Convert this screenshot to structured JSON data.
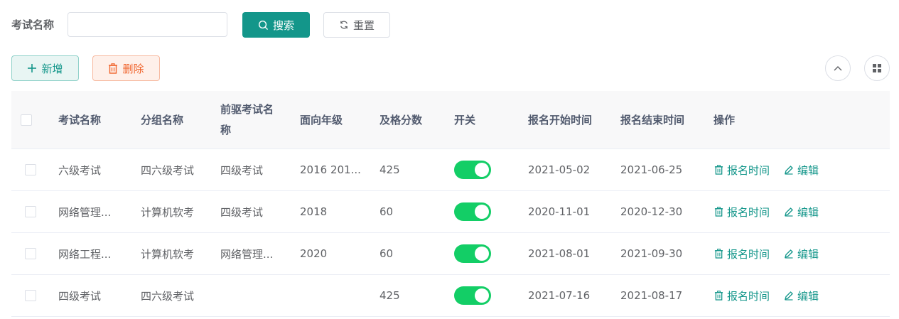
{
  "search": {
    "label": "考试名称",
    "input_value": "",
    "input_placeholder": "",
    "search_label": "搜索",
    "reset_label": "重置"
  },
  "toolbar": {
    "add_label": "新增",
    "delete_label": "删除"
  },
  "table": {
    "headers": [
      "考试名称",
      "分组名称",
      "前驱考试名称",
      "面向年级",
      "及格分数",
      "开关",
      "报名开始时间",
      "报名结束时间",
      "操作"
    ],
    "action_labels": {
      "time": "报名时间",
      "edit": "编辑"
    },
    "rows": [
      {
        "name": "六级考试",
        "group": "四六级考试",
        "prev": "四级考试",
        "grade": "2016 201...",
        "pass": "425",
        "enabled": true,
        "start": "2021-05-02",
        "end": "2021-06-25"
      },
      {
        "name": "网络管理...",
        "group": "计算机软考",
        "prev": "四级考试",
        "grade": "2018",
        "pass": "60",
        "enabled": true,
        "start": "2020-11-01",
        "end": "2020-12-30"
      },
      {
        "name": "网络工程...",
        "group": "计算机软考",
        "prev": "网络管理...",
        "grade": "2020",
        "pass": "60",
        "enabled": true,
        "start": "2021-08-01",
        "end": "2021-09-30"
      },
      {
        "name": "四级考试",
        "group": "四六级考试",
        "prev": "",
        "grade": "",
        "pass": "425",
        "enabled": true,
        "start": "2021-07-16",
        "end": "2021-08-17"
      }
    ]
  },
  "colors": {
    "primary": "#13968a",
    "danger": "#f0642c",
    "switch_on": "#13ce66"
  },
  "icons": {
    "search": "search-icon",
    "reset": "refresh-icon",
    "add": "plus-icon",
    "delete": "trash-icon",
    "collapse": "chevron-up-icon",
    "columns": "grid-icon",
    "time_action": "trash-icon",
    "edit_action": "pencil-icon"
  }
}
